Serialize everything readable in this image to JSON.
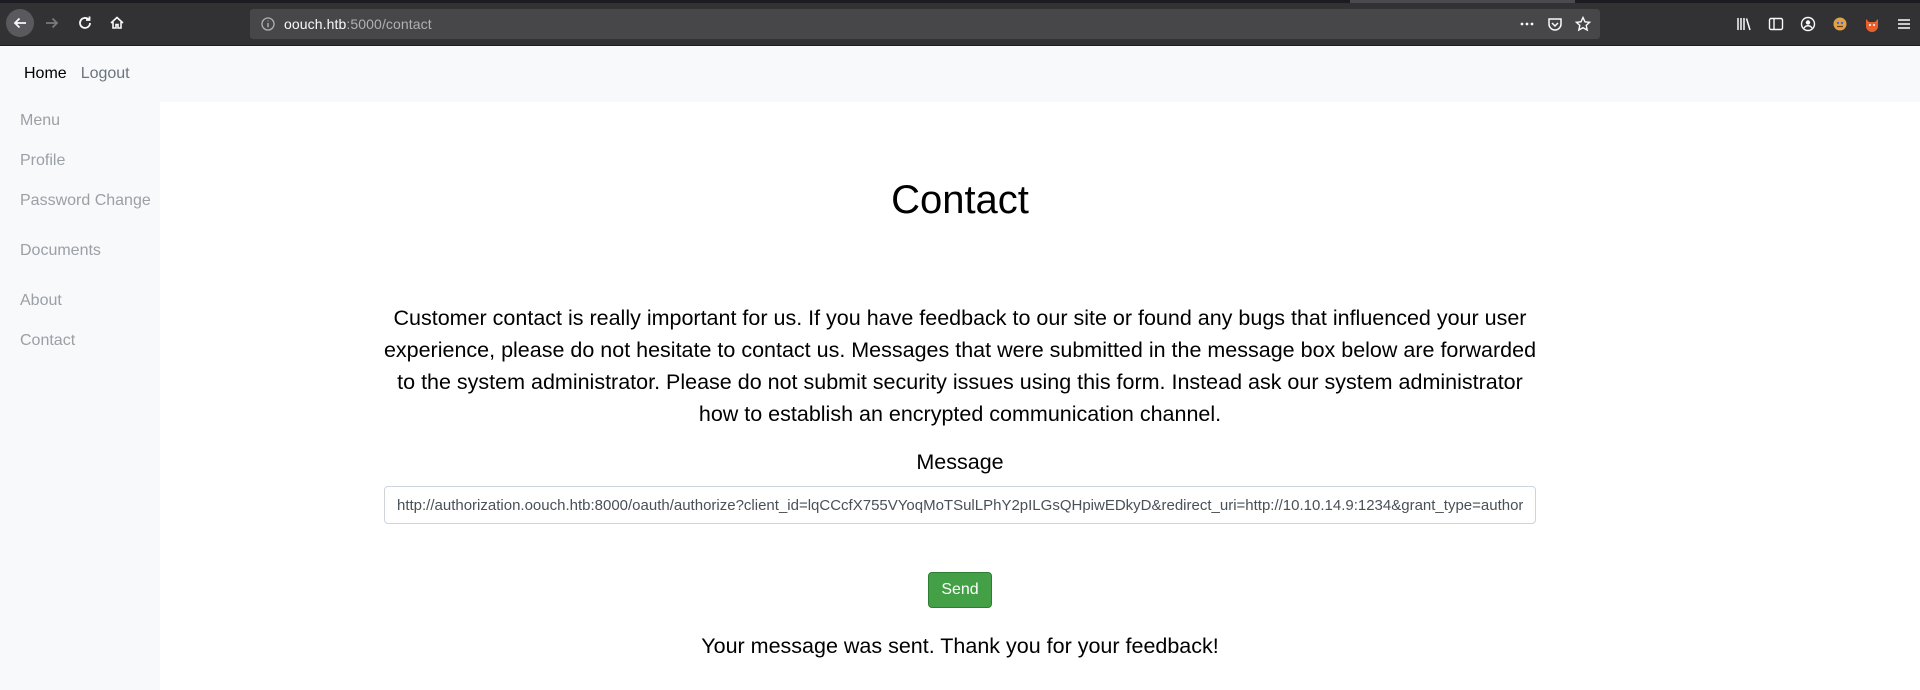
{
  "browser": {
    "url_host": "oouch.htb",
    "url_path": ":5000/contact"
  },
  "topnav": {
    "home": "Home",
    "logout": "Logout"
  },
  "sidebar": {
    "items": [
      {
        "label": "Menu"
      },
      {
        "label": "Profile"
      },
      {
        "label": "Password Change"
      },
      {
        "label": "Documents"
      },
      {
        "label": "About"
      },
      {
        "label": "Contact"
      }
    ]
  },
  "main": {
    "title": "Contact",
    "intro": "Customer contact is really important for us. If you have feedback to our site or found any bugs that influenced your user experience, please do not hesitate to contact us. Messages that were submitted in the message box below are forwarded to the system administrator. Please do not submit security issues using this form. Instead ask our system administrator how to establish an encrypted communication channel.",
    "message_label": "Message",
    "message_value": "http://authorization.oouch.htb:8000/oauth/authorize?client_id=lqCCcfX755VYoqMoTSulLPhY2pILGsQHpiwEDkyD&redirect_uri=http://10.10.14.9:1234&grant_type=authorization_code",
    "send_label": "Send",
    "success_text": "Your message was sent. Thank you for your feedback!"
  }
}
